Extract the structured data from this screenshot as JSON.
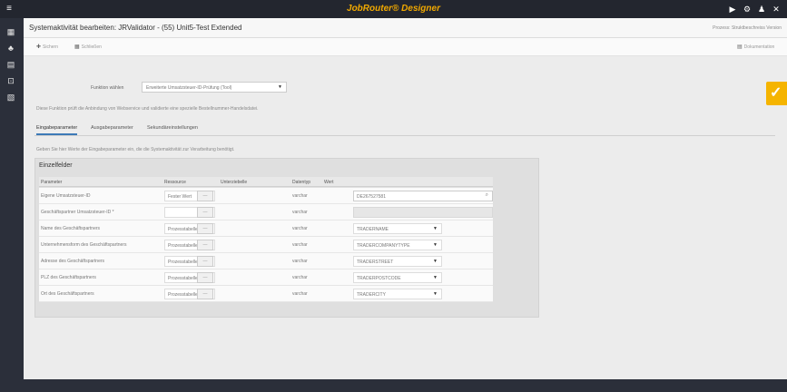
{
  "app": {
    "title": "JobRouter® Designer"
  },
  "window": {
    "title": "Systemaktivität bearbeiten: JRValidator - (55) Unit5-Test Extended",
    "process_info": "Prozess: Struktbeschreiss  Version"
  },
  "toolbar": {
    "save_label": "Sichern",
    "close_label": "Schließen",
    "doc_label": "Dokumentation"
  },
  "function_select": {
    "label": "Funktion wählen",
    "value": "Erweiterte Umsatzsteuer-ID-Prüfung (Tool)"
  },
  "description": "Diese Funktion prüft die Anbindung von Webservice und validierte eine spezielle Bestellnummer-Handelsdatei.",
  "tabs": [
    "Eingabeparameter",
    "Ausgabeparameter",
    "Sekundäreinstellungen"
  ],
  "note": "Geben Sie hier Werte der Eingabeparameter ein, die die Systemaktivität zur Verarbeitung benötigt.",
  "panel": {
    "title": "Einzelfelder",
    "columns": [
      "Parameter",
      "Ressource",
      "Unterziebelle",
      "Datentyp",
      "Wert"
    ],
    "rows": [
      {
        "param": "Eigene Umsatzsteuer-ID",
        "resource": "Fester Wert",
        "sub": "—",
        "type": "varchar",
        "value": "DE267527581",
        "value_kind": "text"
      },
      {
        "param": "Geschäftspartner Umsatzsteuer-ID *",
        "resource": "",
        "sub": "—",
        "type": "varchar",
        "value": "",
        "value_kind": "disabled"
      },
      {
        "param": "Name des Geschäftspartners",
        "resource": "Prozesstabelle",
        "sub": "—",
        "type": "varchar",
        "value": "TRADERNAME",
        "value_kind": "select"
      },
      {
        "param": "Unternehmensform des Geschäftspartners",
        "resource": "Prozesstabelle",
        "sub": "—",
        "type": "varchar",
        "value": "TRADERCOMPANYTYPE",
        "value_kind": "select"
      },
      {
        "param": "Adresse des Geschäftspartners",
        "resource": "Prozesstabelle",
        "sub": "—",
        "type": "varchar",
        "value": "TRADERSTREET",
        "value_kind": "select"
      },
      {
        "param": "PLZ des Geschäftspartners",
        "resource": "Prozesstabelle",
        "sub": "—",
        "type": "varchar",
        "value": "TRADERPOSTCODE",
        "value_kind": "select"
      },
      {
        "param": "Ort des Geschäftspartners",
        "resource": "Prozesstabelle",
        "sub": "—",
        "type": "varchar",
        "value": "TRADERCITY",
        "value_kind": "select"
      }
    ]
  },
  "colors": {
    "accent_tab": "#3d7ab7",
    "brand": "#f0a800",
    "yellow_button": "#f5b400"
  }
}
